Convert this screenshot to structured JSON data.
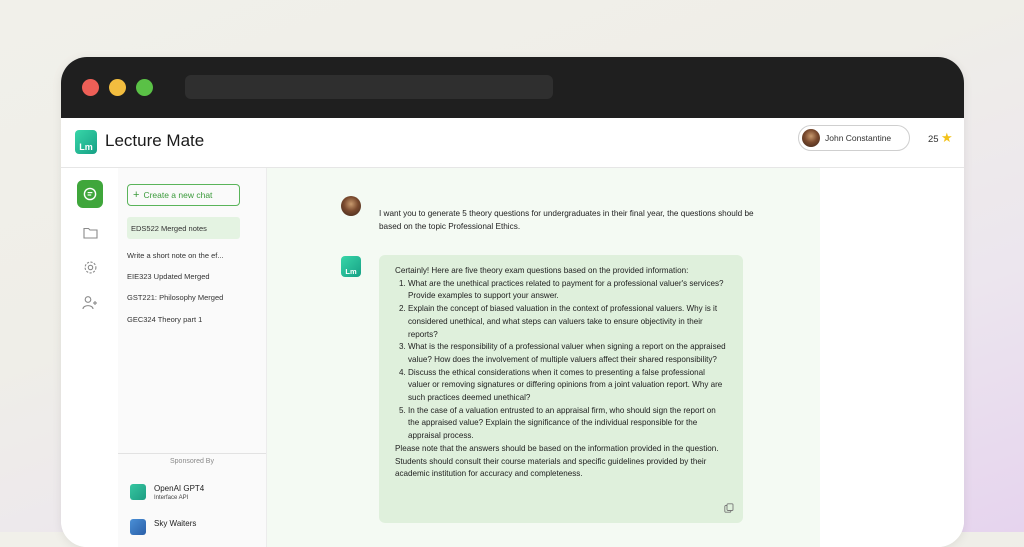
{
  "app": {
    "title": "Lecture Mate",
    "logo_text": "Lm"
  },
  "user": {
    "name": "John Constantine",
    "credits": "25",
    "star_glyph": "★"
  },
  "sidebar": {
    "new_chat_label": "Create a new chat",
    "new_chat_icon": "+",
    "chats": [
      {
        "label": "EDS522 Merged notes",
        "active": true
      },
      {
        "label": "Write a short note on the ef...",
        "active": false
      },
      {
        "label": "EIE323 Updated Merged",
        "active": false
      },
      {
        "label": "GST221: Philosophy Merged",
        "active": false
      },
      {
        "label": "GEC324 Theory part 1",
        "active": false
      }
    ],
    "sponsored_label": "Sponsored By",
    "sponsors": [
      {
        "name": "OpenAI GPT4",
        "sub": "Interface API"
      },
      {
        "name": "Sky Waiters",
        "sub": ""
      }
    ]
  },
  "rail": {
    "icons": [
      "chat-icon",
      "folder-icon",
      "settings-icon",
      "add-user-icon"
    ]
  },
  "conversation": {
    "user_message": "I want you to generate 5 theory questions for undergraduates in their final year, the questions should be based on the topic Professional Ethics.",
    "bot_intro": "Certainly! Here are five theory exam questions based on the provided information:",
    "bot_items": [
      "What are the unethical practices related to payment for a professional valuer's services? Provide examples to support your answer.",
      "Explain the concept of biased valuation in the context of professional valuers. Why is it considered unethical, and what steps can valuers take to ensure objectivity in their reports?",
      "What is the responsibility of a professional valuer when signing a report on the appraised value? How does the involvement of multiple valuers affect their shared responsibility?",
      "Discuss the ethical considerations when it comes to presenting a false professional valuer or removing signatures or differing opinions from a joint valuation report. Why are such practices deemed unethical?",
      "In the case of a valuation entrusted to an appraisal firm, who should sign the report on the appraised value? Explain the significance of the individual responsible for the appraisal process."
    ],
    "bot_outro": "Please note that the answers should be based on the information provided in the question. Students should consult their course materials and specific guidelines provided by their academic institution for accuracy and completeness."
  },
  "colors": {
    "accent": "#3fa63b",
    "brand": "#16a085",
    "star": "#f3c21a",
    "titlebar": "#1f1f1f"
  }
}
